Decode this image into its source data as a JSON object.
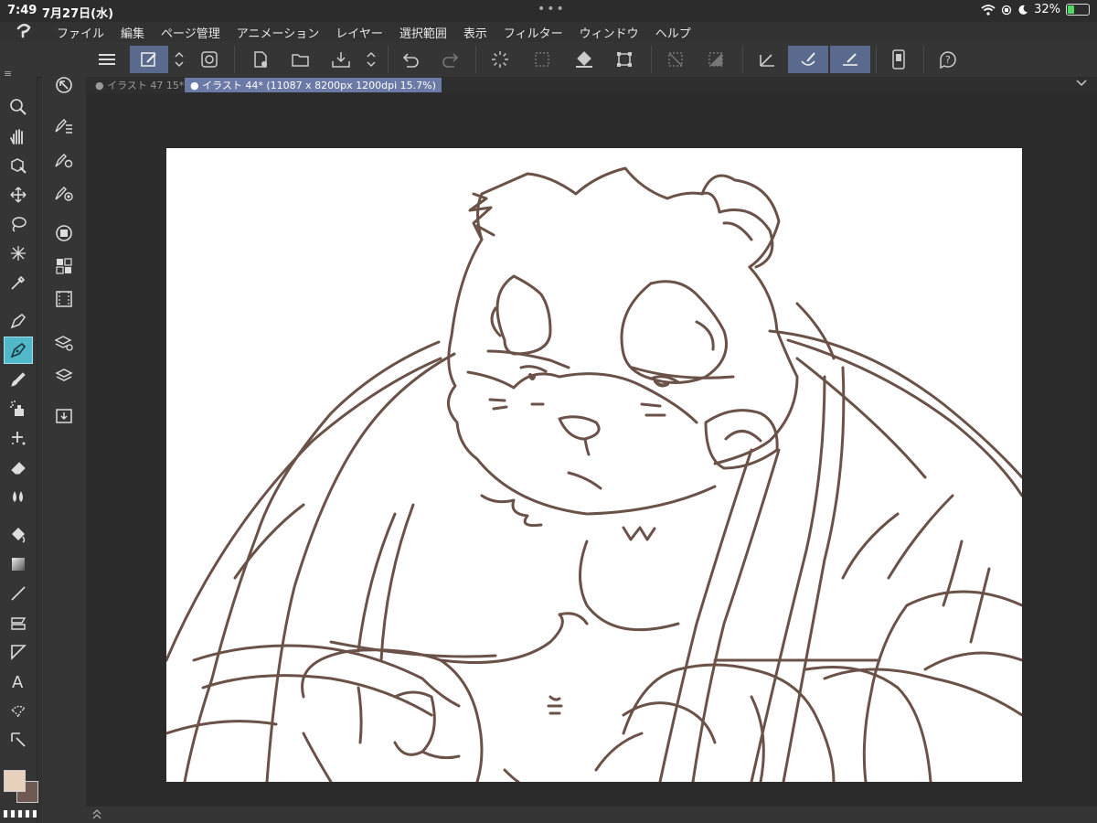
{
  "status_bar": {
    "time": "7:49",
    "date": "7月27日(水)",
    "multitask_dots": "•••",
    "battery_percent": "32%",
    "battery_level": 0.32
  },
  "menu": {
    "items": [
      "ファイル",
      "編集",
      "ページ管理",
      "アニメーション",
      "レイヤー",
      "選択範囲",
      "表示",
      "フィルター",
      "ウィンドウ",
      "ヘルプ"
    ]
  },
  "tabs": [
    {
      "label": "● イラスト 47 15*",
      "active": false
    },
    {
      "label": "● イラスト 44* (11087 x 8200px 1200dpi 15.7%)",
      "active": true
    }
  ],
  "colors": {
    "main_color": "#e8d2bc",
    "sub_color": "#6e5a52",
    "accent": "#5a6a8e",
    "active_tool": "#50b8c8",
    "line_color": "#6b5249"
  },
  "tools": [
    "search-icon",
    "hand-icon",
    "object-icon",
    "move-icon",
    "lasso-icon",
    "magic-wand-icon",
    "eyedropper-icon",
    "pen-icon",
    "pencil-icon",
    "brush-icon",
    "airbrush-icon",
    "decoration-icon",
    "eraser-icon",
    "blend-icon",
    "fill-icon",
    "gradient-icon",
    "line-icon",
    "frame-icon",
    "ruler-icon",
    "text-icon",
    "balloon-icon",
    "correct-line-icon"
  ],
  "subtools": [
    "navigator-icon",
    "tool-property-icon",
    "tool-settings-icon",
    "brush-size-icon",
    "color-wheel-icon",
    "color-set-icon",
    "animation-icon",
    "layer-property-icon",
    "layers-icon",
    "material-icon"
  ]
}
